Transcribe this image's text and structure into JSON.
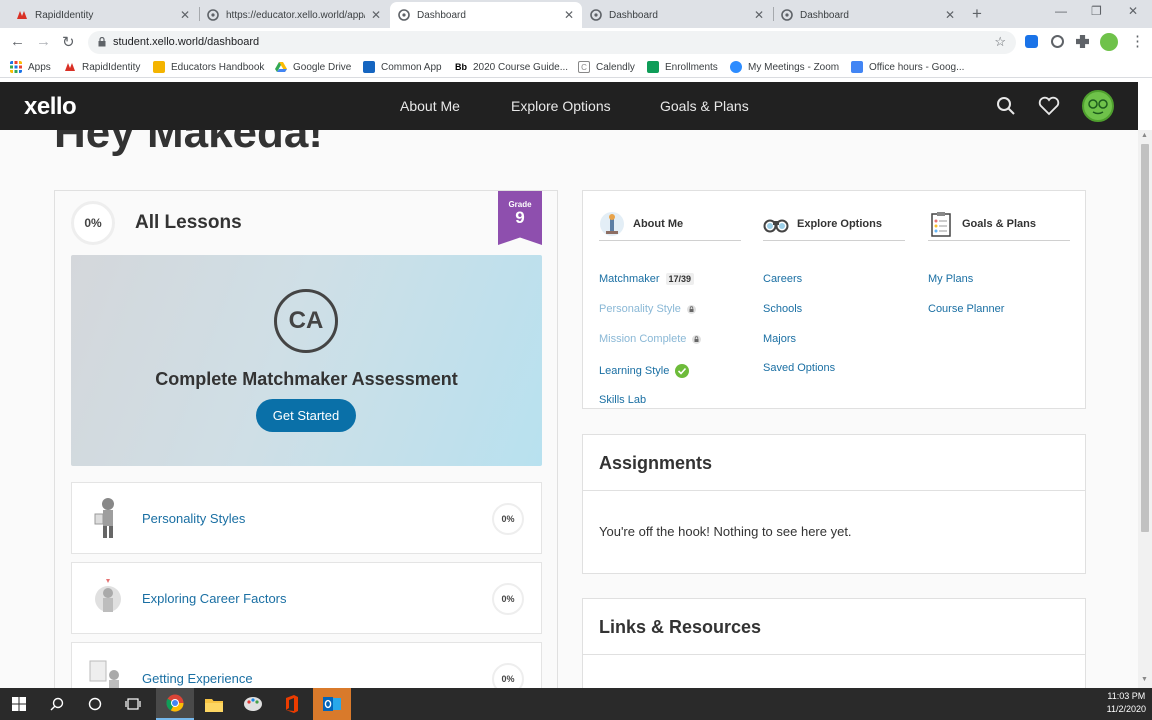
{
  "browser": {
    "tabs": [
      {
        "title": "RapidIdentity",
        "icon": "rapididentity-icon",
        "active": false
      },
      {
        "title": "https://educator.xello.world/app/",
        "icon": "xello-favicon",
        "active": false
      },
      {
        "title": "Dashboard",
        "icon": "xello-favicon",
        "active": true
      },
      {
        "title": "Dashboard",
        "icon": "xello-favicon",
        "active": false
      },
      {
        "title": "Dashboard",
        "icon": "xello-favicon",
        "active": false
      }
    ],
    "new_tab": "+",
    "url": "student.xello.world/dashboard",
    "bookmarks": [
      {
        "label": "Apps",
        "icon": "apps-grid-icon"
      },
      {
        "label": "RapidIdentity",
        "icon": "rapididentity-icon"
      },
      {
        "label": "Educators Handbook",
        "icon": "handbook-icon"
      },
      {
        "label": "Google Drive",
        "icon": "google-drive-icon"
      },
      {
        "label": "Common App",
        "icon": "common-app-icon"
      },
      {
        "label": "2020 Course Guide...",
        "icon": "blackboard-icon"
      },
      {
        "label": "Calendly",
        "icon": "calendly-icon"
      },
      {
        "label": "Enrollments",
        "icon": "sheets-icon"
      },
      {
        "label": "My Meetings - Zoom",
        "icon": "zoom-icon"
      },
      {
        "label": "Office hours - Goog...",
        "icon": "docs-icon"
      }
    ]
  },
  "app": {
    "logo": "xello",
    "nav": [
      "About Me",
      "Explore Options",
      "Goals & Plans"
    ],
    "greeting": "Hey Makeda!"
  },
  "lessons": {
    "percent": "0%",
    "title": "All Lessons",
    "grade_label": "Grade",
    "grade_value": "9",
    "assessment": {
      "initials": "CA",
      "title": "Complete Matchmaker Assessment",
      "button": "Get Started"
    },
    "items": [
      {
        "name": "Personality Styles",
        "percent": "0%"
      },
      {
        "name": "Exploring Career Factors",
        "percent": "0%"
      },
      {
        "name": "Getting Experience",
        "percent": "0%"
      }
    ]
  },
  "quick_links": {
    "about_me": {
      "title": "About Me",
      "links": [
        {
          "label": "Matchmaker",
          "badge": "17/39"
        },
        {
          "label": "Personality Style",
          "locked": true
        },
        {
          "label": "Mission Complete",
          "locked": true
        },
        {
          "label": "Learning Style",
          "completed": true
        },
        {
          "label": "Skills Lab"
        }
      ]
    },
    "explore_options": {
      "title": "Explore Options",
      "links": [
        "Careers",
        "Schools",
        "Majors",
        "Saved Options"
      ]
    },
    "goals_plans": {
      "title": "Goals & Plans",
      "links": [
        "My Plans",
        "Course Planner"
      ]
    }
  },
  "assignments": {
    "title": "Assignments",
    "empty_message": "You're off the hook! Nothing to see here yet."
  },
  "links_resources": {
    "title": "Links & Resources"
  },
  "taskbar": {
    "time": "11:03 PM",
    "date": "11/2/2020"
  },
  "colors": {
    "brand_dark": "#212121",
    "link_blue": "#1a6fa3",
    "button_blue": "#0a70a8",
    "grade_purple": "#8e4fae",
    "avatar_green": "#6fc24a"
  }
}
